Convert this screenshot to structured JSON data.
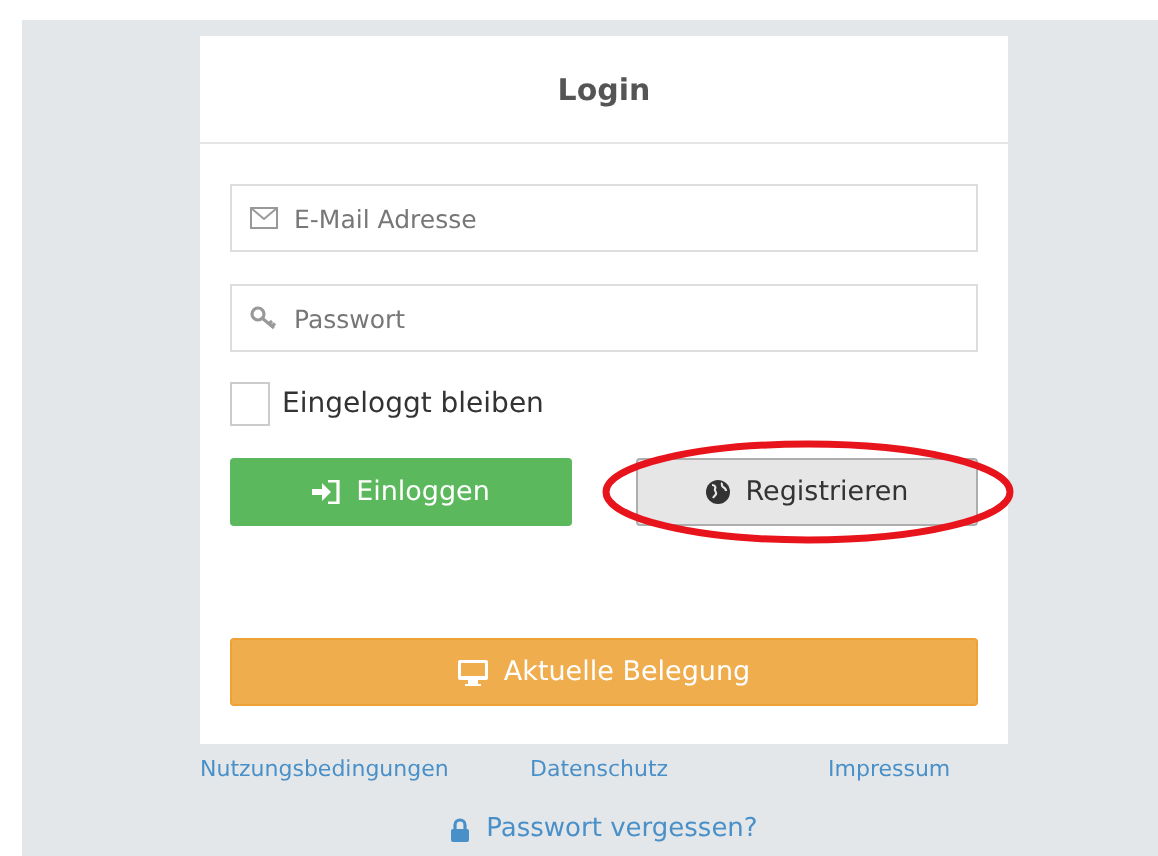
{
  "login_card": {
    "title": "Login",
    "fields": [
      {
        "kind": "email",
        "placeholder": "E-Mail Adresse"
      },
      {
        "kind": "password",
        "placeholder": "Passwort"
      }
    ],
    "remember_me": {
      "label": "Eingeloggt bleiben",
      "checked": false
    },
    "buttons": [
      {
        "kind": "login",
        "label": "Einloggen",
        "highlighted": false
      },
      {
        "kind": "register",
        "label": "Registrieren",
        "highlighted": true
      }
    ],
    "occupancy_button": {
      "label": "Aktuelle Belegung"
    }
  },
  "footer_links": [
    "Nutzungsbedingungen",
    "Datenschutz",
    "Impressum"
  ],
  "forgot_password": "Passwort vergessen?"
}
